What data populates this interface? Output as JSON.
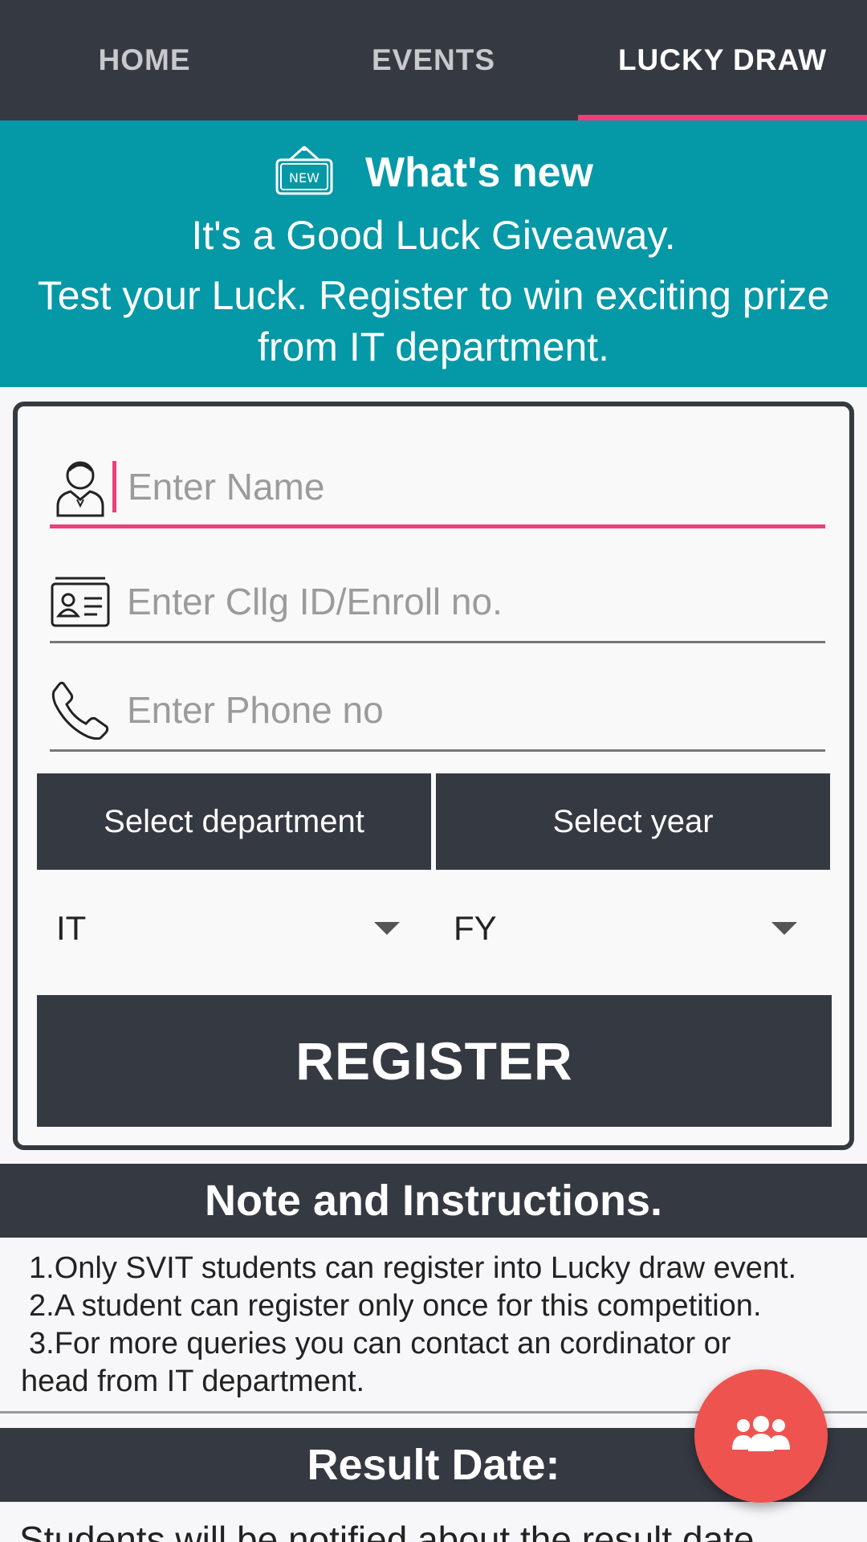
{
  "tabs": [
    {
      "label": "HOME",
      "active": false
    },
    {
      "label": "EVENTS",
      "active": false
    },
    {
      "label": "LUCKY DRAW",
      "active": true
    }
  ],
  "banner": {
    "badge_icon": "new-sign-icon",
    "badge_text": "NEW",
    "title": "What's new",
    "line1": "It's a Good Luck Giveaway.",
    "line2": "Test your Luck. Register to win exciting prize from IT department."
  },
  "form": {
    "name": {
      "placeholder": "Enter Name",
      "value": "",
      "icon": "person-icon"
    },
    "id": {
      "placeholder": "Enter Cllg ID/Enroll no.",
      "value": "",
      "icon": "id-card-icon"
    },
    "phone": {
      "placeholder": "Enter Phone no",
      "value": "",
      "icon": "phone-icon"
    },
    "department_button": "Select department",
    "year_button": "Select year",
    "department_value": "IT",
    "year_value": "FY",
    "register_label": "REGISTER"
  },
  "notes": {
    "title": "Note and Instructions.",
    "items": [
      "1.Only SVIT students can register into Lucky draw event.",
      "2.A student can register only once for this competition.",
      "3.For more queries you can contact an cordinator or",
      "head  from IT department."
    ]
  },
  "result": {
    "title": "Result Date:",
    "text": "Students will be notified about the result date"
  },
  "fab": {
    "icon": "group-icon"
  },
  "colors": {
    "dark": "#353942",
    "teal": "#0598a6",
    "accent": "#ec407a",
    "fab": "#ef5350"
  }
}
